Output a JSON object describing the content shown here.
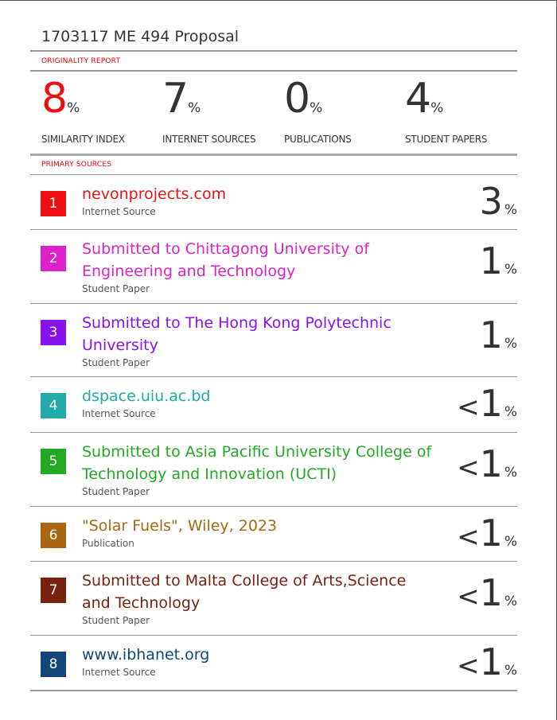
{
  "document": {
    "title": "1703117 ME 494 Proposal"
  },
  "originality_report": {
    "label": "ORIGINALITY REPORT",
    "stats": [
      {
        "value": "8",
        "unit": "%",
        "label": "SIMILARITY INDEX",
        "color": "#e81010"
      },
      {
        "value": "7",
        "unit": "%",
        "label": "INTERNET SOURCES",
        "color": "#333333"
      },
      {
        "value": "0",
        "unit": "%",
        "label": "PUBLICATIONS",
        "color": "#333333"
      },
      {
        "value": "4",
        "unit": "%",
        "label": "STUDENT PAPERS",
        "color": "#333333"
      }
    ]
  },
  "primary_sources": {
    "label": "PRIMARY SOURCES",
    "items": [
      {
        "rank": "1",
        "title_lines": [
          "nevonprojects.com"
        ],
        "type": "Internet Source",
        "prefix": "",
        "value": "3",
        "unit": "%",
        "color": "#ee1111"
      },
      {
        "rank": "2",
        "title_lines": [
          "Submitted to Chittagong University of",
          "Engineering and Technology"
        ],
        "type": "Student Paper",
        "prefix": "",
        "value": "1",
        "unit": "%",
        "color": "#dd22cc"
      },
      {
        "rank": "3",
        "title_lines": [
          "Submitted to The Hong Kong Polytechnic",
          "University"
        ],
        "type": "Student Paper",
        "prefix": "",
        "value": "1",
        "unit": "%",
        "color": "#8811ee"
      },
      {
        "rank": "4",
        "title_lines": [
          "dspace.uiu.ac.bd"
        ],
        "type": "Internet Source",
        "prefix": "<",
        "value": "1",
        "unit": "%",
        "color": "#22aaaa"
      },
      {
        "rank": "5",
        "title_lines": [
          "Submitted to Asia Pacific University College of",
          "Technology and Innovation (UCTI)"
        ],
        "type": "Student Paper",
        "prefix": "<",
        "value": "1",
        "unit": "%",
        "color": "#22aa22"
      },
      {
        "rank": "6",
        "title_lines": [
          "\"Solar Fuels\", Wiley, 2023"
        ],
        "type": "Publication",
        "prefix": "<",
        "value": "1",
        "unit": "%",
        "color": "#aa6611"
      },
      {
        "rank": "7",
        "title_lines": [
          "Submitted to Malta College of Arts,Science",
          "and Technology"
        ],
        "type": "Student Paper",
        "prefix": "<",
        "value": "1",
        "unit": "%",
        "color": "#772211"
      },
      {
        "rank": "8",
        "title_lines": [
          "www.ibhanet.org"
        ],
        "type": "Internet Source",
        "prefix": "<",
        "value": "1",
        "unit": "%",
        "color": "#114477"
      }
    ]
  }
}
